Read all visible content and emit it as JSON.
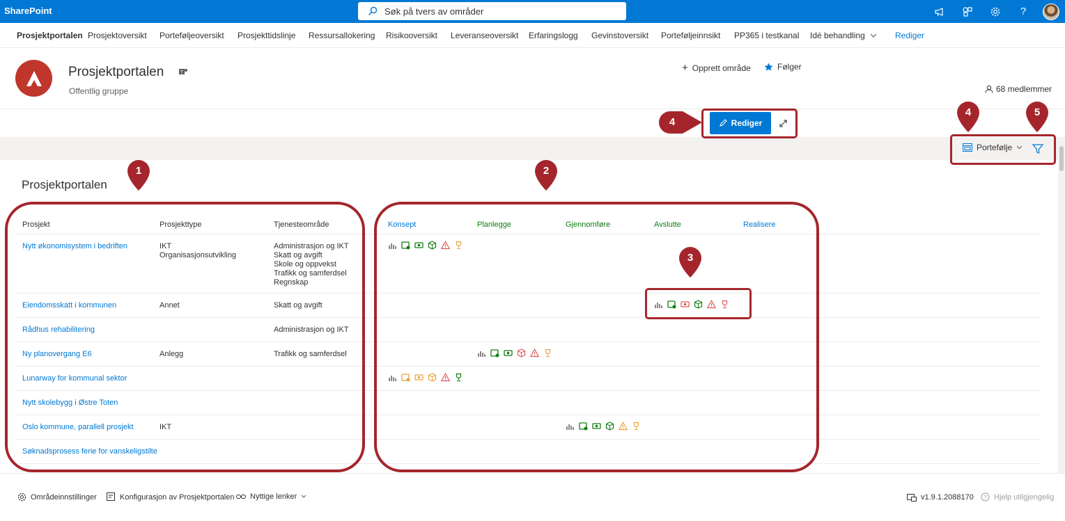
{
  "suite": {
    "brand": "SharePoint",
    "search_placeholder": "Søk på tvers av områder"
  },
  "hubnav": {
    "items": [
      "Prosjektportalen",
      "Prosjektoversikt",
      "Porteføljeoversikt",
      "Prosjekttidslinje",
      "Ressursallokering",
      "Risikooversikt",
      "Leveranseoversikt",
      "Erfaringslogg",
      "Gevinstoversikt",
      "Porteføljeinnsikt",
      "PP365 i testkanal",
      "Idé behandling"
    ],
    "edit_label": "Rediger"
  },
  "site": {
    "title": "Prosjektportalen",
    "subtitle": "Offentlig gruppe",
    "create_label": "Opprett område",
    "follow_label": "Følger",
    "members_label": "68 medlemmer"
  },
  "toolbar": {
    "edit_label": "Rediger",
    "portfolio_label": "Portefølje"
  },
  "main": {
    "section_title": "Prosjektportalen",
    "columns": [
      "Prosjekt",
      "Prosjekttype",
      "Tjenesteområde"
    ],
    "phases": [
      {
        "label": "Konsept",
        "color": "#0078d4"
      },
      {
        "label": "Planlegge",
        "color": "#107c10"
      },
      {
        "label": "Gjennomføre",
        "color": "#107c10"
      },
      {
        "label": "Avslutte",
        "color": "#107c10"
      },
      {
        "label": "Realisere",
        "color": "#0078d4"
      }
    ],
    "rows": [
      {
        "name": "Nytt økonomisystem i bedriften",
        "type": "IKT\nOrganisasjonsutvikling",
        "area": "Administrasjon og IKT\nSkatt og avgift\nSkole og oppvekst\nTrafikk og samferdsel\nRegnskap"
      },
      {
        "name": "Eiendomsskatt i kommunen",
        "type": "Annet",
        "area": "Skatt og avgift"
      },
      {
        "name": "Rådhus rehabilitering",
        "type": "",
        "area": "Administrasjon og IKT"
      },
      {
        "name": "Ny planovergang E6",
        "type": "Anlegg",
        "area": "Trafikk og samferdsel"
      },
      {
        "name": "Lunarway for kommunal sektor",
        "type": "",
        "area": ""
      },
      {
        "name": "Nytt skolebygg i Østre Toten",
        "type": "",
        "area": ""
      },
      {
        "name": "Oslo kommune, parallell prosjekt",
        "type": "IKT",
        "area": ""
      },
      {
        "name": "Søknadsprosess ferie for vanskeligstilte",
        "type": "",
        "area": ""
      }
    ]
  },
  "annotations": [
    "1",
    "2",
    "3",
    "4",
    "4",
    "5"
  ],
  "footer": {
    "settings_label": "Områdeinnstillinger",
    "config_label": "Konfigurasjon av Prosjektportalen",
    "links_label": "Nyttige lenker",
    "version_label": "v1.9.1.2088170",
    "help_label": "Hjelp utilgjengelig"
  },
  "colors": {
    "accent": "#0078d4",
    "annotation": "#a4262c",
    "site_logo": "#c0362c",
    "ok": "#107c10",
    "warn": "#e8a33d",
    "bad": "#e05a5a"
  }
}
